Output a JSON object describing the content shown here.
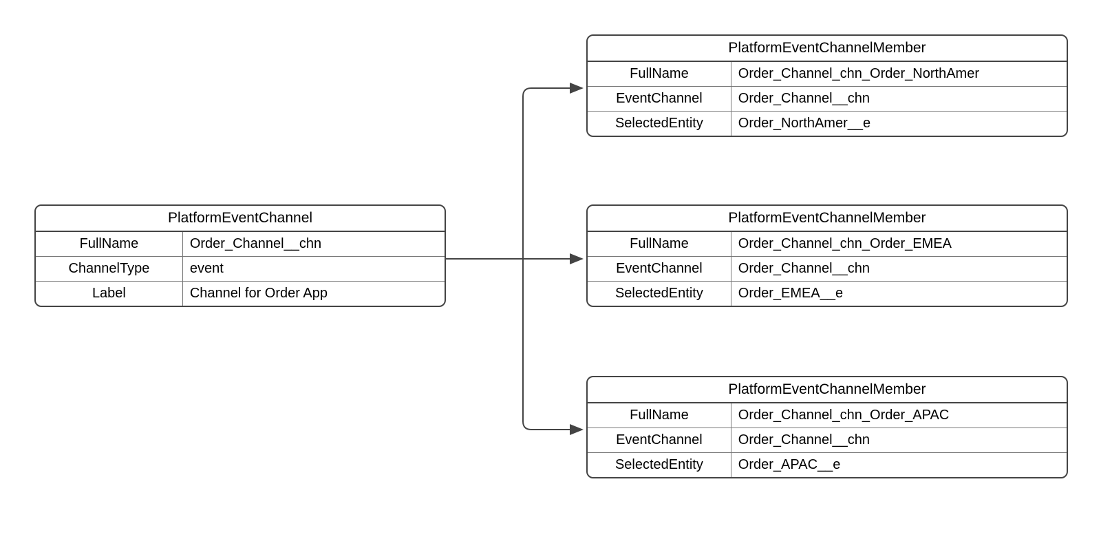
{
  "left": {
    "title": "PlatformEventChannel",
    "rows": [
      {
        "key": "FullName",
        "val": "Order_Channel__chn"
      },
      {
        "key": "ChannelType",
        "val": "event"
      },
      {
        "key": "Label",
        "val": "Channel for Order App"
      }
    ]
  },
  "members": [
    {
      "title": "PlatformEventChannelMember",
      "rows": [
        {
          "key": "FullName",
          "val": "Order_Channel_chn_Order_NorthAmer"
        },
        {
          "key": "EventChannel",
          "val": "Order_Channel__chn"
        },
        {
          "key": "SelectedEntity",
          "val": "Order_NorthAmer__e"
        }
      ]
    },
    {
      "title": "PlatformEventChannelMember",
      "rows": [
        {
          "key": "FullName",
          "val": "Order_Channel_chn_Order_EMEA"
        },
        {
          "key": "EventChannel",
          "val": "Order_Channel__chn"
        },
        {
          "key": "SelectedEntity",
          "val": "Order_EMEA__e"
        }
      ]
    },
    {
      "title": "PlatformEventChannelMember",
      "rows": [
        {
          "key": "FullName",
          "val": "Order_Channel_chn_Order_APAC"
        },
        {
          "key": "EventChannel",
          "val": "Order_Channel__chn"
        },
        {
          "key": "SelectedEntity",
          "val": "Order_APAC__e"
        }
      ]
    }
  ]
}
